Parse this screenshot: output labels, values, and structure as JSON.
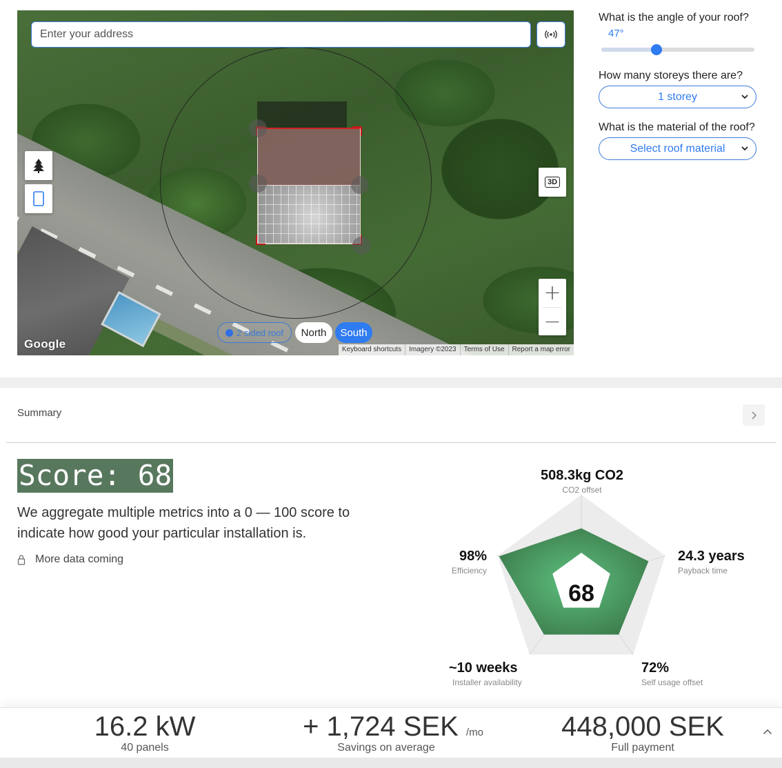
{
  "map": {
    "address_placeholder": "Enter your address",
    "locate_icon": "signal-tower-icon",
    "tree_icon": "tree-icon",
    "panel_icon": "panel-rectangle-icon",
    "view_3d_label": "3D",
    "zoom_in_label": "+",
    "zoom_out_label": "−",
    "orientation": {
      "roof_type_label": "2 sided roof",
      "north_label": "North",
      "south_label": "South",
      "selected": "South"
    },
    "google_logo": "Google",
    "attribution": [
      "Keyboard shortcuts",
      "Imagery ©2023",
      "Terms of Use",
      "Report a map error"
    ]
  },
  "panel": {
    "angle_question": "What is the angle of your roof?",
    "angle_value": "47°",
    "angle_fraction": 0.36,
    "storeys_question": "How many storeys there are?",
    "storeys_value": "1 storey",
    "material_question": "What is the material of the roof?",
    "material_value": "Select roof material",
    "accent_color": "#2f7bf0"
  },
  "summary": {
    "label": "Summary",
    "score_title": "Score: 68",
    "description": "We aggregate multiple metrics into a 0 — 100 score to indicate how good your particular installation is.",
    "more_data": "More data coming",
    "score_value": "68",
    "metrics": [
      {
        "value": "508.3kg CO2",
        "label": "CO2 offset",
        "fraction": 0.62
      },
      {
        "value": "24.3 years",
        "label": "Payback time",
        "fraction": 0.8
      },
      {
        "value": "72%",
        "label": "Self usage offset",
        "fraction": 0.72
      },
      {
        "value": "~10 weeks",
        "label": "Installer availability",
        "fraction": 0.72
      },
      {
        "value": "98%",
        "label": "Efficiency",
        "fraction": 0.98
      }
    ],
    "radar_fill_color": "#3f8a54"
  },
  "bottom": {
    "power_value": "16.2 kW",
    "power_label": "40 panels",
    "savings_value": "+ 1,724 SEK",
    "savings_unit": "/mo",
    "savings_label": "Savings on average",
    "payment_value": "448,000 SEK",
    "payment_label": "Full payment",
    "collapse_icon": "chevron-up-icon"
  }
}
